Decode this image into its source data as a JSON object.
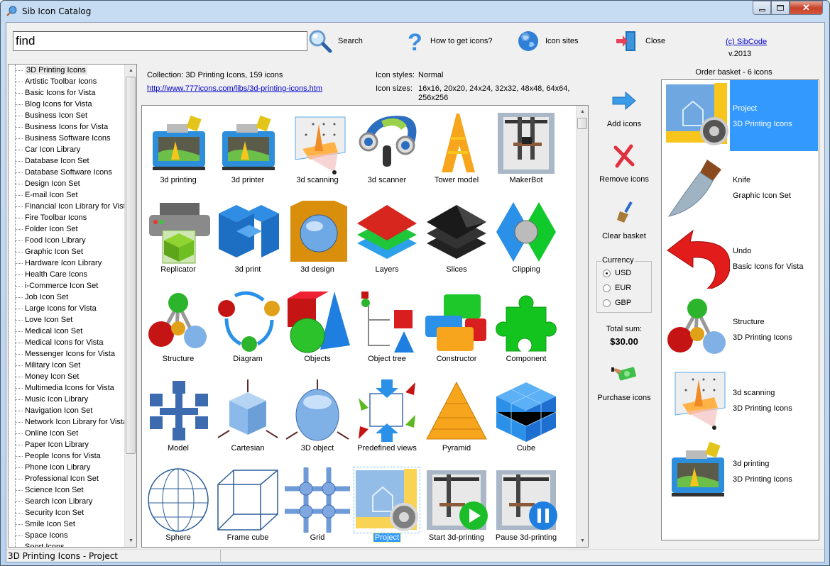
{
  "window": {
    "title": "Sib Icon Catalog",
    "controls": {
      "minimize": "minimize",
      "maximize": "maximize",
      "close": "close"
    }
  },
  "toolbar": {
    "search_value": "find",
    "search_label": "Search",
    "help_label": "How to get icons?",
    "sites_label": "Icon sites",
    "close_label": "Close",
    "copyright_link": "(c) SibCode",
    "version": "v.2013"
  },
  "collections": [
    "3D Printing Icons",
    "Artistic Toolbar Icons",
    "Basic Icons for Vista",
    "Blog Icons for Vista",
    "Business Icon Set",
    "Business Icons for Vista",
    "Business Software Icons",
    "Car Icon Library",
    "Database Icon Set",
    "Database Software Icons",
    "Design Icon Set",
    "E-mail Icon Set",
    "Financial Icon Library for Vista",
    "Fire Toolbar Icons",
    "Folder Icon Set",
    "Food Icon Library",
    "Graphic Icon Set",
    "Hardware Icon Library",
    "Health Care Icons",
    "i-Commerce Icon Set",
    "Job Icon Set",
    "Large Icons for Vista",
    "Love Icon Set",
    "Medical Icon Set",
    "Medical Icons for Vista",
    "Messenger Icons for Vista",
    "Military Icon Set",
    "Money Icon Set",
    "Multimedia Icons for Vista",
    "Music Icon Library",
    "Navigation Icon Set",
    "Network Icon Library for Vista",
    "Online Icon Set",
    "Paper Icon Library",
    "People Icons for Vista",
    "Phone Icon Library",
    "Professional Icon Set",
    "Science Icon Set",
    "Search Icon Library",
    "Security Icon Set",
    "Smile Icon Set",
    "Space Icons",
    "Sport Icons"
  ],
  "selected_collection": "3D Printing Icons",
  "info": {
    "collection_line": "Collection: 3D Printing Icons, 159 icons",
    "url": "http://www.777icons.com/libs/3d-printing-icons.htm",
    "styles_label": "Icon styles:",
    "styles_value": "Normal",
    "sizes_label": "Icon sizes:",
    "sizes_value_1": "16x16, 20x20, 24x24, 32x32, 48x48, 64x64,",
    "sizes_value_2": "256x256"
  },
  "icons": [
    {
      "name": "3d printing",
      "icon": "printer-3d-icon"
    },
    {
      "name": "3d printer",
      "icon": "printer-3d-icon"
    },
    {
      "name": "3d scanning",
      "icon": "scanning-icon"
    },
    {
      "name": "3d scanner",
      "icon": "scanner-icon"
    },
    {
      "name": "Tower model",
      "icon": "tower-icon"
    },
    {
      "name": "MakerBot",
      "icon": "makerbot-icon"
    },
    {
      "name": "Replicator",
      "icon": "replicator-icon"
    },
    {
      "name": "3d print",
      "icon": "blocks-icon"
    },
    {
      "name": "3d design",
      "icon": "design-icon"
    },
    {
      "name": "Layers",
      "icon": "layers-icon"
    },
    {
      "name": "Slices",
      "icon": "slices-icon"
    },
    {
      "name": "Clipping",
      "icon": "clipping-icon"
    },
    {
      "name": "Structure",
      "icon": "structure-icon"
    },
    {
      "name": "Diagram",
      "icon": "diagram-icon"
    },
    {
      "name": "Objects",
      "icon": "objects-icon"
    },
    {
      "name": "Object tree",
      "icon": "object-tree-icon"
    },
    {
      "name": "Constructor",
      "icon": "constructor-icon"
    },
    {
      "name": "Component",
      "icon": "puzzle-icon"
    },
    {
      "name": "Model",
      "icon": "model-icon"
    },
    {
      "name": "Cartesian",
      "icon": "cartesian-icon"
    },
    {
      "name": "3D object",
      "icon": "sphere-object-icon"
    },
    {
      "name": "Predefined views",
      "icon": "views-icon"
    },
    {
      "name": "Pyramid",
      "icon": "pyramid-icon"
    },
    {
      "name": "Cube",
      "icon": "cube-icon"
    },
    {
      "name": "Sphere",
      "icon": "wire-sphere-icon"
    },
    {
      "name": "Frame cube",
      "icon": "frame-cube-icon"
    },
    {
      "name": "Grid",
      "icon": "grid-icon"
    },
    {
      "name": "Project",
      "icon": "project-icon",
      "selected": true
    },
    {
      "name": "Start 3d-printing",
      "icon": "start-print-icon"
    },
    {
      "name": "Pause 3d-printing",
      "icon": "pause-print-icon"
    }
  ],
  "actions": {
    "add": "Add icons",
    "remove": "Remove icons",
    "clear": "Clear basket",
    "currency_legend": "Currency",
    "currencies": [
      "USD",
      "EUR",
      "GBP"
    ],
    "currency_selected": "USD",
    "total_label": "Total sum:",
    "total_value": "$30.00",
    "purchase": "Purchase icons"
  },
  "basket": {
    "title": "Order basket - 6 icons",
    "items": [
      {
        "name": "Project",
        "collection": "3D Printing Icons",
        "icon": "project-icon",
        "selected": true
      },
      {
        "name": "Knife",
        "collection": "Graphic Icon Set",
        "icon": "knife-icon"
      },
      {
        "name": "Undo",
        "collection": "Basic Icons for Vista",
        "icon": "undo-icon"
      },
      {
        "name": "Structure",
        "collection": "3D Printing Icons",
        "icon": "structure-icon"
      },
      {
        "name": "3d scanning",
        "collection": "3D Printing Icons",
        "icon": "scanning-icon"
      },
      {
        "name": "3d printing",
        "collection": "3D Printing Icons",
        "icon": "printer-3d-icon"
      }
    ]
  },
  "status": {
    "text": "3D Printing Icons - Project"
  },
  "colors": {
    "selection": "#3399ff",
    "link": "#0000cc"
  }
}
